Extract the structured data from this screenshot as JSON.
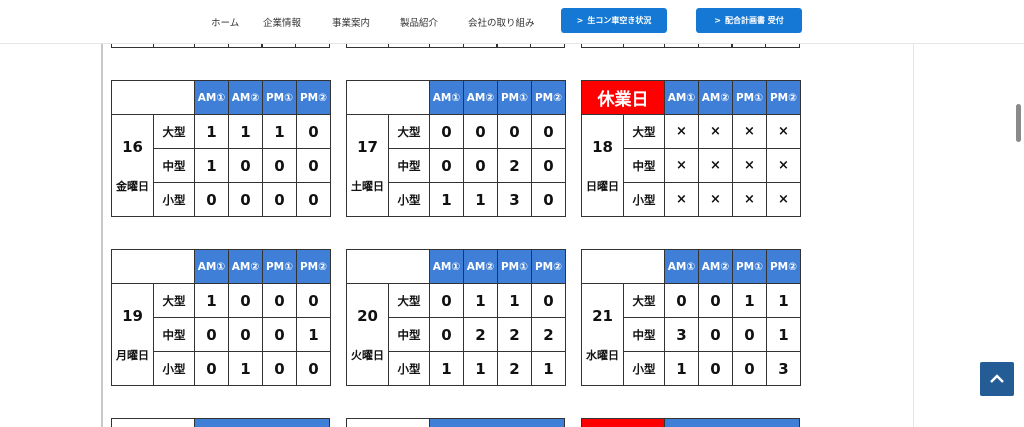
{
  "nav": {
    "items": [
      "ホーム",
      "企業情報",
      "事業案内",
      "製品紹介",
      "会社の取り組み"
    ],
    "button1": "生コン車空き状況",
    "button2": "配合計画書 受付",
    "chevron": ">"
  },
  "slots": [
    "AM①",
    "AM②",
    "PM①",
    "PM②"
  ],
  "sizes": [
    "大型",
    "中型",
    "小型"
  ],
  "days": [
    {
      "num": "16",
      "weekday": "金曜日",
      "holiday": false,
      "values": [
        [
          "1",
          "1",
          "1",
          "0"
        ],
        [
          "1",
          "0",
          "0",
          "0"
        ],
        [
          "0",
          "0",
          "0",
          "0"
        ]
      ]
    },
    {
      "num": "17",
      "weekday": "土曜日",
      "holiday": false,
      "values": [
        [
          "0",
          "0",
          "0",
          "0"
        ],
        [
          "0",
          "0",
          "2",
          "0"
        ],
        [
          "1",
          "1",
          "3",
          "0"
        ]
      ]
    },
    {
      "num": "18",
      "weekday": "日曜日",
      "holiday": true,
      "holiday_label": "休業日",
      "values": [
        [
          "×",
          "×",
          "×",
          "×"
        ],
        [
          "×",
          "×",
          "×",
          "×"
        ],
        [
          "×",
          "×",
          "×",
          "×"
        ]
      ]
    },
    {
      "num": "19",
      "weekday": "月曜日",
      "holiday": false,
      "values": [
        [
          "1",
          "0",
          "0",
          "0"
        ],
        [
          "0",
          "0",
          "0",
          "1"
        ],
        [
          "0",
          "1",
          "0",
          "0"
        ]
      ]
    },
    {
      "num": "20",
      "weekday": "火曜日",
      "holiday": false,
      "values": [
        [
          "0",
          "1",
          "1",
          "0"
        ],
        [
          "0",
          "2",
          "2",
          "2"
        ],
        [
          "1",
          "1",
          "2",
          "1"
        ]
      ]
    },
    {
      "num": "21",
      "weekday": "水曜日",
      "holiday": false,
      "values": [
        [
          "0",
          "0",
          "1",
          "1"
        ],
        [
          "3",
          "0",
          "0",
          "1"
        ],
        [
          "1",
          "0",
          "0",
          "3"
        ]
      ]
    }
  ],
  "colors": {
    "header_blue": "#3f7fd7",
    "holiday_red": "#ff0000",
    "button_blue": "#1478d4",
    "to_top": "#245c96"
  },
  "icons": {
    "to_top": "chevron-up-icon"
  }
}
